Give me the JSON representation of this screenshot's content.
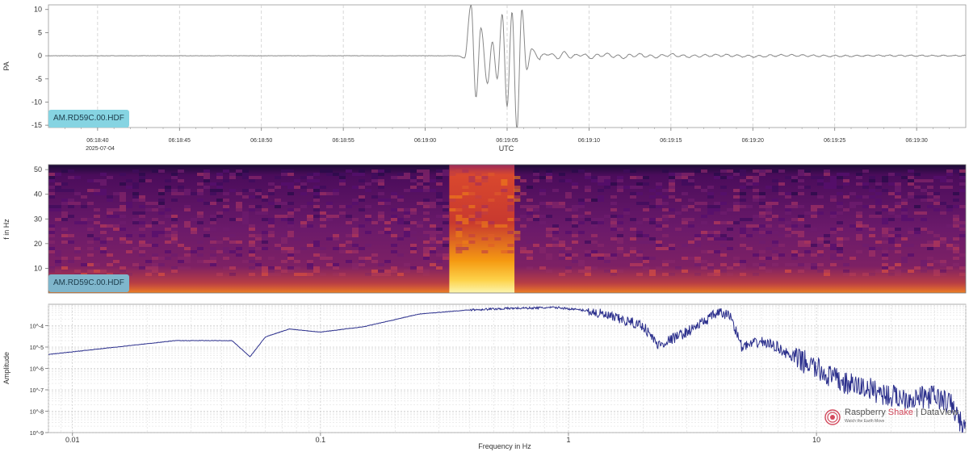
{
  "colors": {
    "waveform": "#888888",
    "spectrum": "#2b2f8c",
    "badge1": "#86d4e2",
    "badge2": "#7fb6cc",
    "grid": "#cccccc"
  },
  "chart_data": [
    {
      "type": "line",
      "label": "AM.RD59C.00.HDF",
      "ylabel": "PA",
      "xlabel": "UTC",
      "date": "2025-07-04",
      "x_ticks": [
        "06:18:40",
        "06:18:45",
        "06:18:50",
        "06:18:55",
        "06:19:00",
        "06:19:05",
        "06:19:10",
        "06:19:15",
        "06:19:20",
        "06:19:25",
        "06:19:30"
      ],
      "y_ticks": [
        "10",
        "5",
        "0",
        "-5",
        "-10",
        "-15"
      ],
      "ylim": [
        -15.5,
        11
      ],
      "xlim_seconds": [
        2017,
        2073
      ],
      "grid": "vertical dashed",
      "series": [
        {
          "t": [
            2017,
            2042,
            2042.4,
            2042.8,
            2043.1,
            2043.4,
            2043.8,
            2044.1,
            2044.4,
            2044.7,
            2045,
            2045.3,
            2045.6,
            2045.9,
            2046.2,
            2046.5,
            2047,
            2047.5,
            2048,
            2048.5,
            2049,
            2049.5,
            2050,
            2051,
            2052,
            2053,
            2054,
            2055,
            2056,
            2058,
            2060,
            2062,
            2065,
            2068,
            2073
          ],
          "values": [
            0,
            0,
            -0.5,
            11,
            -9,
            6,
            -6,
            3,
            -5,
            9,
            -11,
            9.5,
            -16,
            10,
            -3,
            1.5,
            -0.8,
            1,
            -0.6,
            0.8,
            -0.4,
            0.6,
            -0.5,
            0.4,
            -0.4,
            0.3,
            -0.3,
            0.3,
            -0.2,
            0.2,
            -0.2,
            0.15,
            -0.1,
            0.05,
            0
          ]
        }
      ]
    },
    {
      "type": "heatmap",
      "label": "AM.RD59C.00.HDF",
      "ylabel": "f in Hz",
      "y_ticks": [
        "50",
        "40",
        "30",
        "20",
        "10"
      ],
      "ylim": [
        0,
        52
      ],
      "colormap": "inferno",
      "event_window_fraction": [
        0.437,
        0.508
      ]
    },
    {
      "type": "line",
      "xlabel": "Frequency in Hz",
      "ylabel": "Amplitude",
      "x_scale": "log",
      "y_scale": "log",
      "xlim": [
        0.008,
        40
      ],
      "ylim": [
        1e-09,
        0.001
      ],
      "x_ticks": [
        "0.01",
        "0.1",
        "1",
        "10"
      ],
      "y_ticks": [
        "10^-4",
        "10^-5",
        "10^-6",
        "10^-7",
        "10^-8",
        "10^-9"
      ],
      "series": [
        {
          "x": [
            0.008,
            0.026,
            0.044,
            0.052,
            0.06,
            0.075,
            0.1,
            0.15,
            0.25,
            0.4,
            0.6,
            0.9,
            1.2,
            1.6,
            2.0,
            2.3,
            3.0,
            3.5,
            4.0,
            4.5,
            5.0,
            6.0,
            7.0,
            8.0,
            9.0,
            11,
            13,
            16,
            20,
            25,
            30,
            35,
            40
          ],
          "y": [
            4.5e-06,
            2e-05,
            2e-05,
            3.5e-06,
            3e-05,
            7e-05,
            5e-05,
            9e-05,
            0.00035,
            0.00055,
            0.00065,
            0.0007,
            0.0005,
            0.0002,
            0.0001,
            1.2e-05,
            5e-05,
            0.00015,
            0.0004,
            0.0003,
            1e-05,
            1.8e-05,
            1e-05,
            3e-06,
            2e-06,
            5e-07,
            2e-07,
            1.2e-07,
            5e-08,
            4e-08,
            5e-08,
            2e-08,
            1e-09
          ]
        }
      ]
    }
  ],
  "logo": {
    "brand_a": "Raspberry ",
    "brand_b": "Shake",
    "separator": " | ",
    "brand_c": "DataView",
    "tagline": "Watch the Earth Move"
  }
}
